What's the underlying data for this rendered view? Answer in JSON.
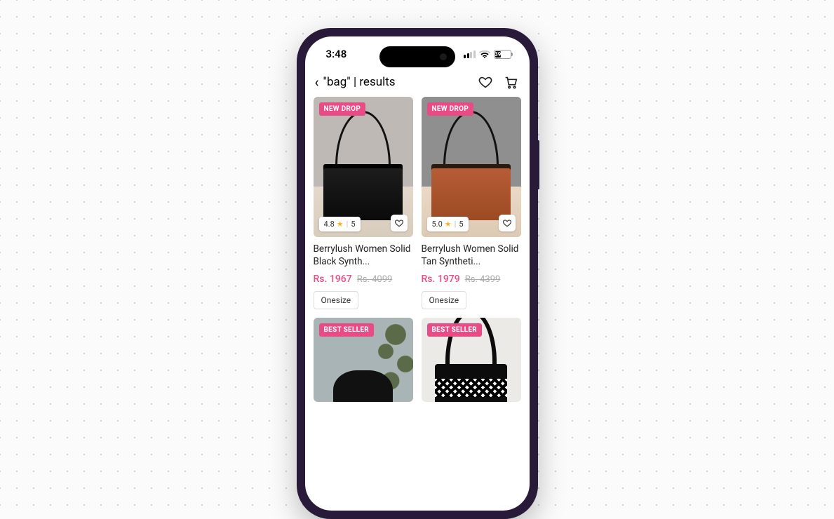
{
  "status": {
    "time": "3:48",
    "battery_pct": "39"
  },
  "nav": {
    "title": "\"bag\" | results"
  },
  "badges": {
    "new_drop": "NEW DROP",
    "best_seller": "BEST SELLER"
  },
  "products": [
    {
      "badge": "NEW DROP",
      "rating": "4.8",
      "rating_count": "5",
      "title": "Berrylush Women Solid Black Synth...",
      "price": "Rs. 1967",
      "price_old": "Rs. 4099",
      "size": "Onesize"
    },
    {
      "badge": "NEW DROP",
      "rating": "5.0",
      "rating_count": "5",
      "title": "Berrylush Women Solid Tan Syntheti...",
      "price": "Rs. 1979",
      "price_old": "Rs. 4399",
      "size": "Onesize"
    },
    {
      "badge": "BEST SELLER"
    },
    {
      "badge": "BEST SELLER"
    }
  ]
}
